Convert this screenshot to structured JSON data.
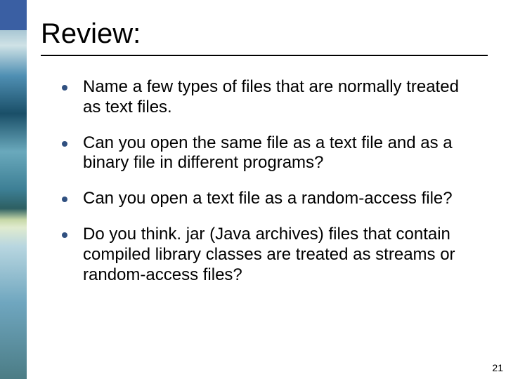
{
  "slide": {
    "title": "Review:",
    "bullets": [
      "Name a few types of files that are normally treated as text files.",
      "Can you open the same file as a text file and as a binary file in different programs?",
      "Can you open a text file as a random-access file?",
      "Do you think. jar (Java archives) files that contain compiled library classes are treated as streams or random-access files?"
    ],
    "page_number": "21"
  }
}
